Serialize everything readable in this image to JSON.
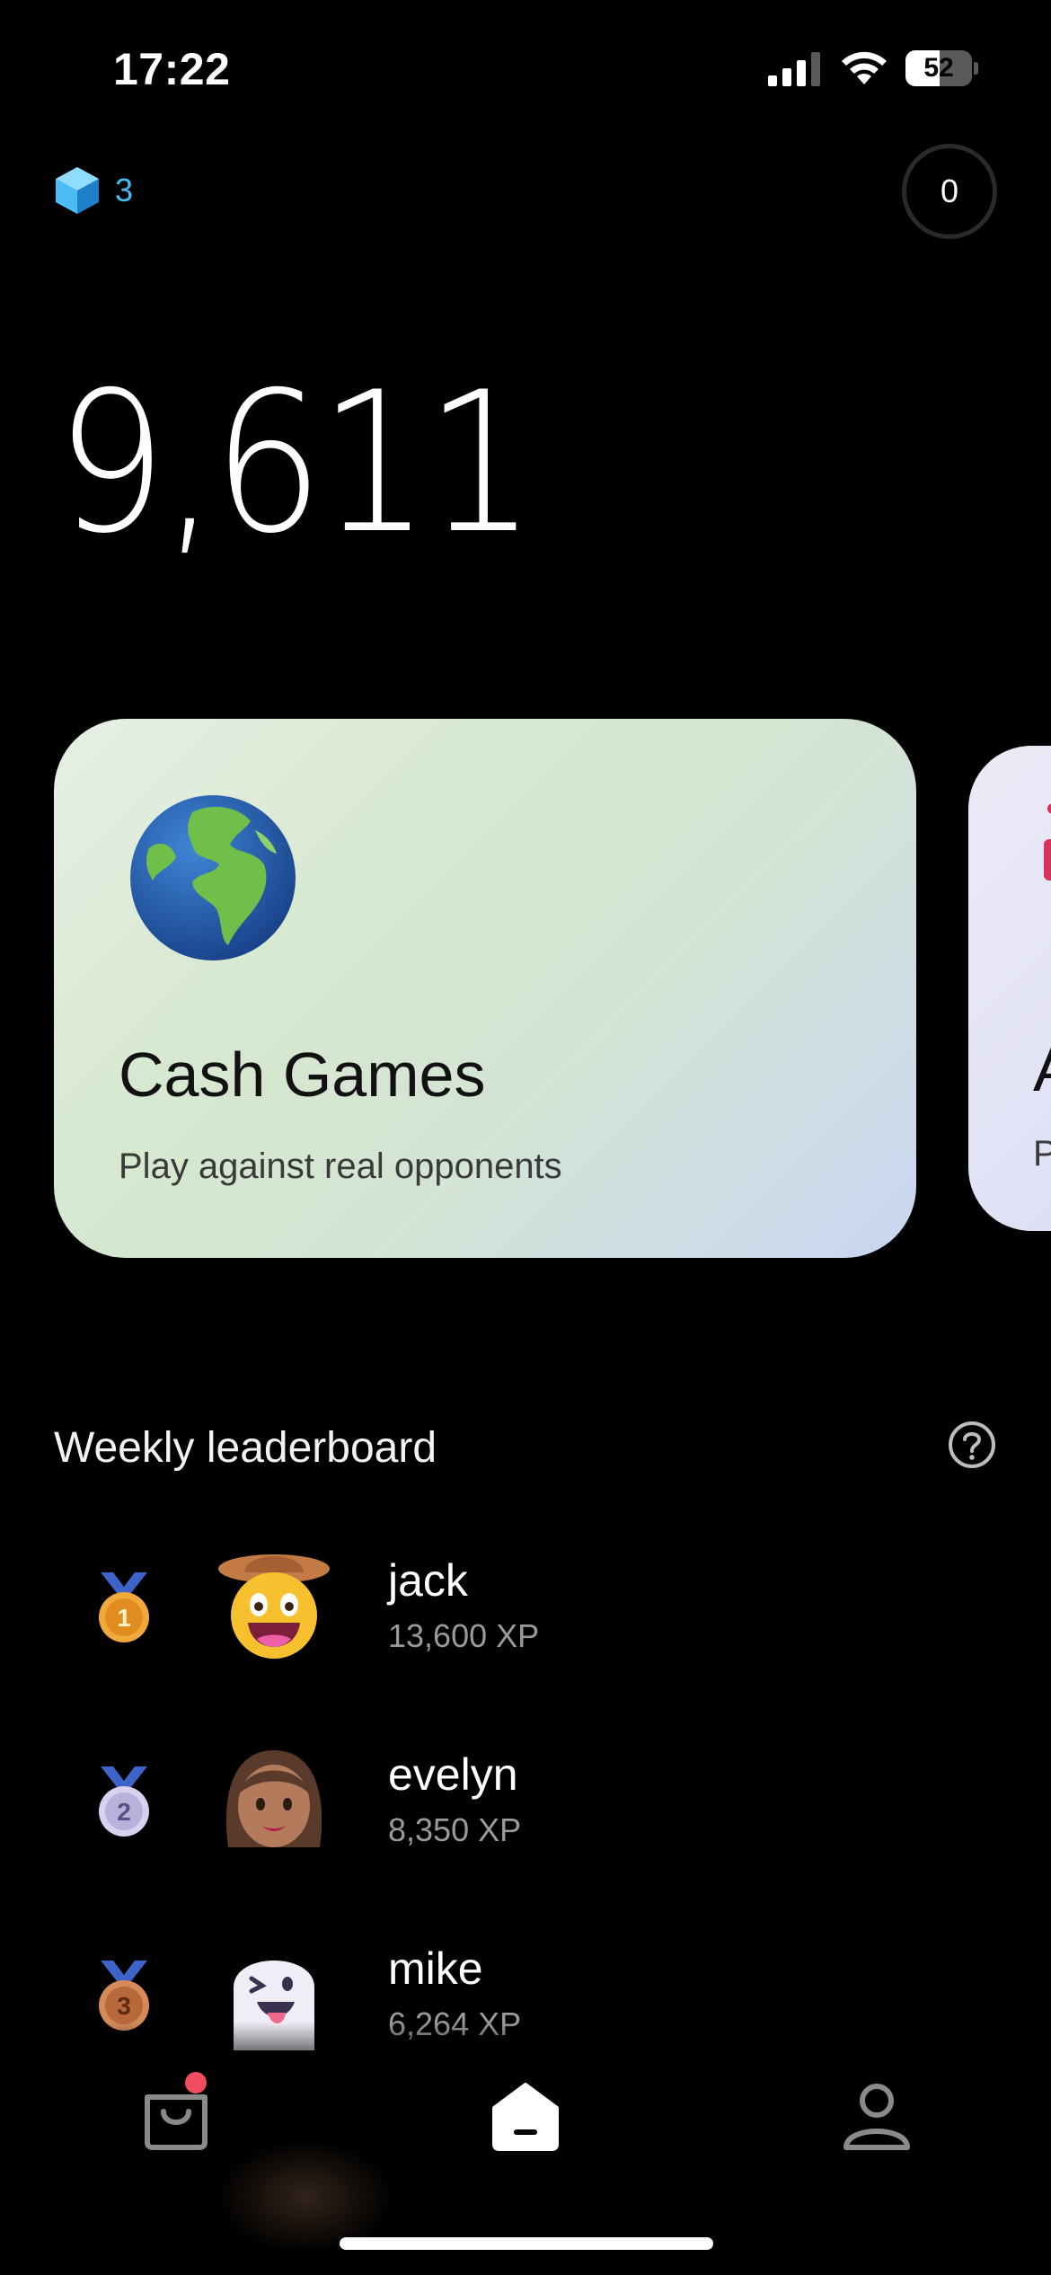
{
  "status_bar": {
    "time": "17:22",
    "battery_level": "52"
  },
  "header": {
    "gem_count": "3",
    "coin_count": "0"
  },
  "balance": "9,611",
  "cards": [
    {
      "title": "Cash Games",
      "subtitle": "Play against real opponents",
      "icon": "globe-icon"
    },
    {
      "title": "A",
      "subtitle": "P",
      "icon": "partial-icon"
    }
  ],
  "leaderboard": {
    "title": "Weekly leaderboard",
    "entries": [
      {
        "rank": "1",
        "name": "jack",
        "xp": "13,600 XP",
        "avatar": "cowboy-face-avatar"
      },
      {
        "rank": "2",
        "name": "evelyn",
        "xp": "8,350 XP",
        "avatar": "woman-face-avatar"
      },
      {
        "rank": "3",
        "name": "mike",
        "xp": "6,264 XP",
        "avatar": "ghost-avatar"
      }
    ]
  },
  "tabbar": {
    "items": [
      "shop-icon",
      "home-icon",
      "profile-icon"
    ],
    "active": "home-icon"
  },
  "colors": {
    "background": "#000000",
    "gem_accent": "#49b9f4",
    "notification_dot": "#f04c5e",
    "card_gradient_start": "#e6efe4",
    "card_gradient_end": "#c9d6f2"
  }
}
